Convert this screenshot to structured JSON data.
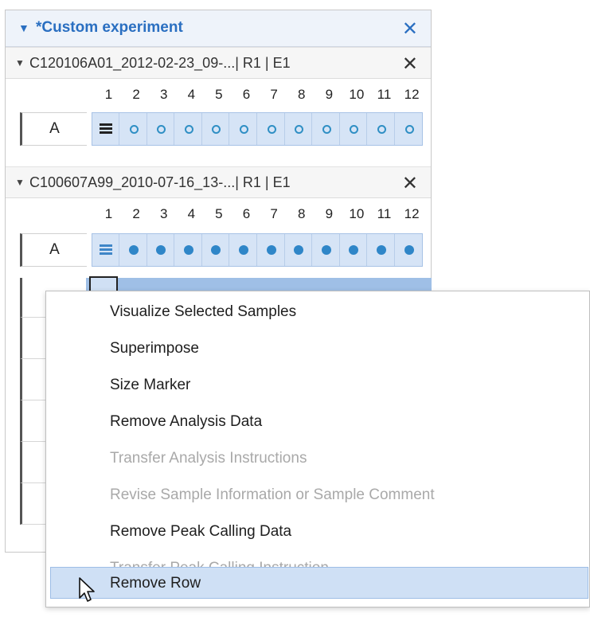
{
  "panel": {
    "title": "*Custom experiment",
    "expand_glyph": "▼",
    "close_glyph": "✕"
  },
  "experiments": [
    {
      "title": "C120106A01_2012-02-23_09-...| R1 | E1",
      "row": "A",
      "markers": [
        "lines",
        "ring",
        "ring",
        "ring",
        "ring",
        "ring",
        "ring",
        "ring",
        "ring",
        "ring",
        "ring",
        "ring"
      ]
    },
    {
      "title": "C100607A99_2010-07-16_13-...| R1 | E1",
      "row": "A",
      "markers": [
        "lines",
        "dot",
        "dot",
        "dot",
        "dot",
        "dot",
        "dot",
        "dot",
        "dot",
        "dot",
        "dot",
        "dot"
      ]
    }
  ],
  "columns": [
    "1",
    "2",
    "3",
    "4",
    "5",
    "6",
    "7",
    "8",
    "9",
    "10",
    "11",
    "12"
  ],
  "context_menu": {
    "items": [
      {
        "label": "Visualize Selected Samples",
        "enabled": true
      },
      {
        "label": "Superimpose",
        "enabled": true
      },
      {
        "label": "Size Marker",
        "enabled": true
      },
      {
        "label": "Remove Analysis Data",
        "enabled": true
      },
      {
        "label": "Transfer Analysis Instructions",
        "enabled": false
      },
      {
        "label": "Revise Sample Information or Sample Comment",
        "enabled": false
      },
      {
        "label": "Remove Peak Calling Data",
        "enabled": true
      },
      {
        "label": "Transfer Peak Calling Instruction",
        "enabled": false
      },
      {
        "label": "Remove Row",
        "enabled": true,
        "highlighted": true
      }
    ]
  },
  "colors": {
    "accent": "#2a6fc1",
    "cell_bg": "#d6e4f6",
    "marker_blue": "#2f86c8",
    "highlight": "#cfe0f5",
    "disabled_text": "#a9a9a9"
  }
}
